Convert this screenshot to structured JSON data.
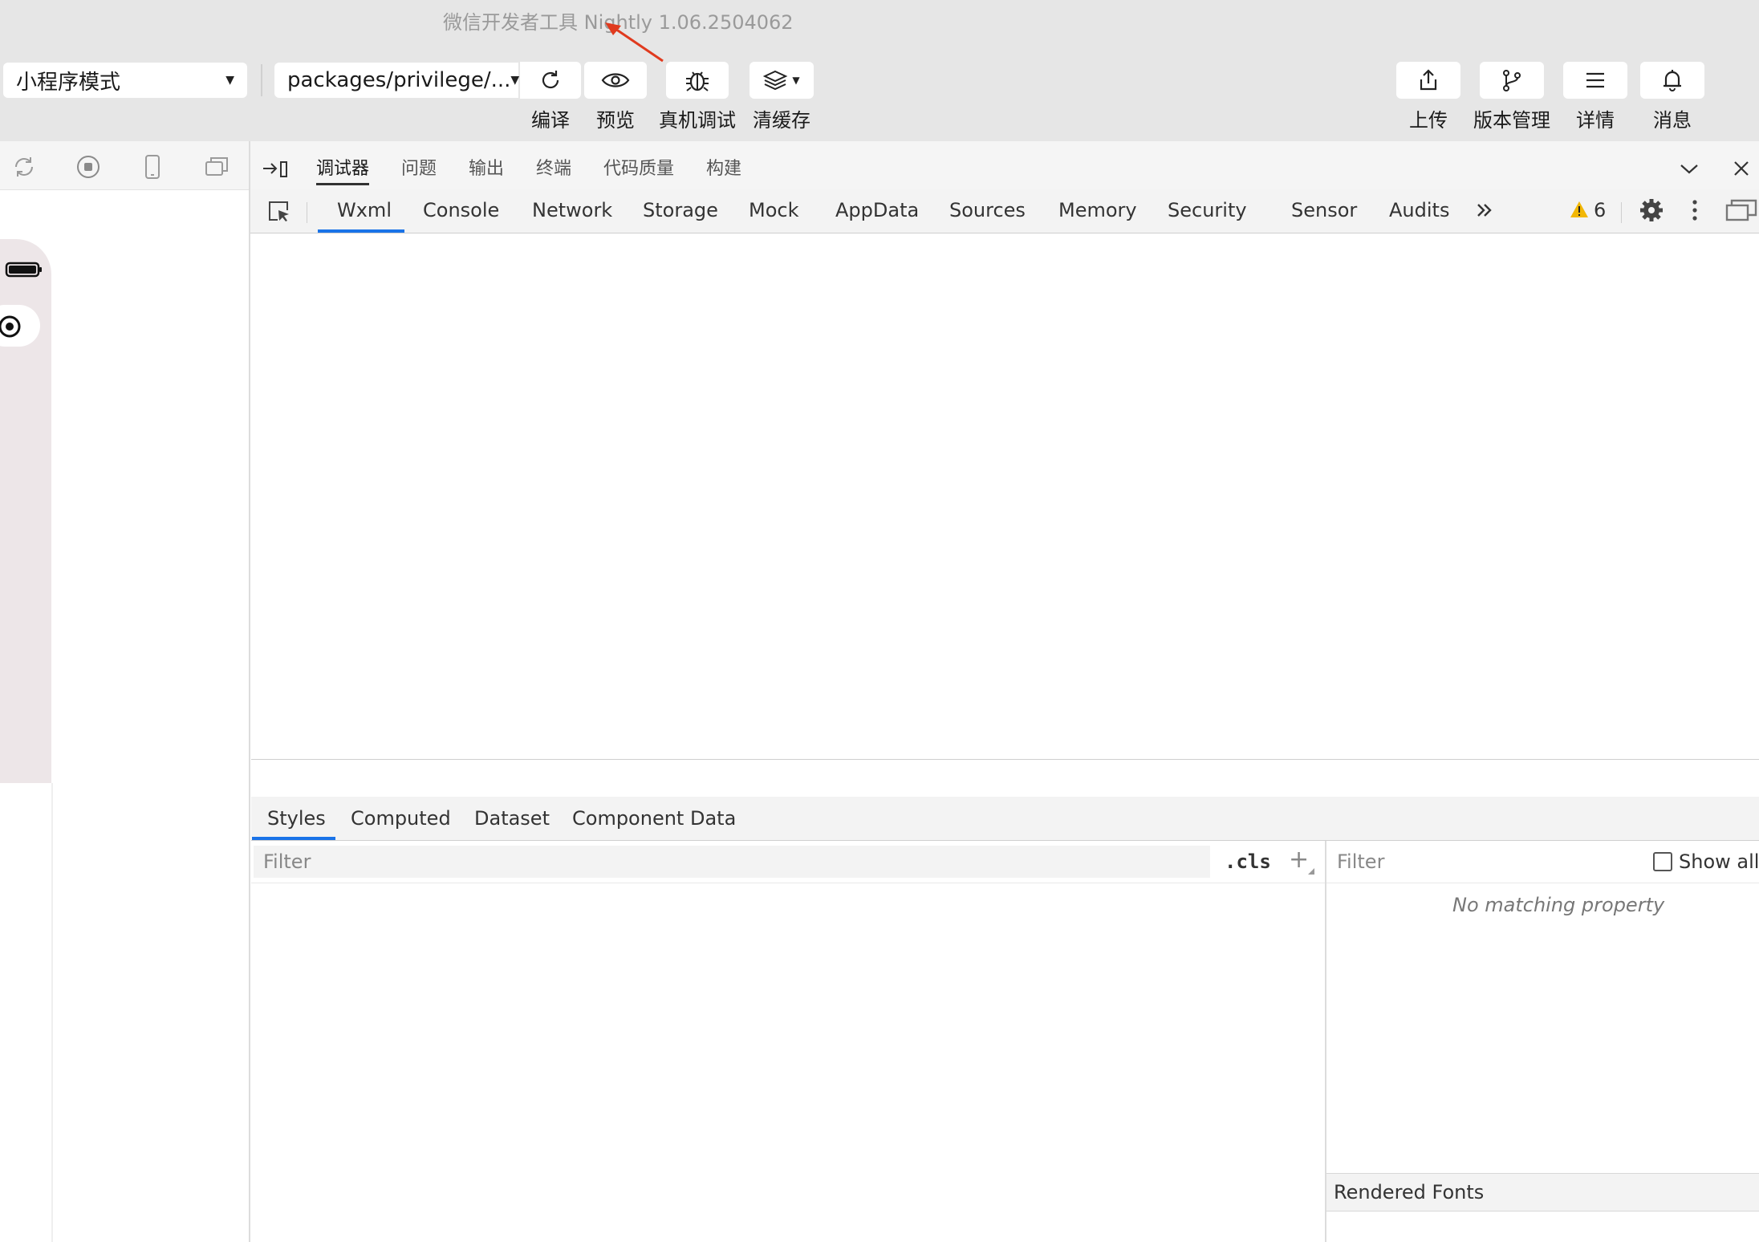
{
  "window": {
    "title": "微信开发者工具 Nightly 1.06.2504062"
  },
  "toolbar": {
    "mode_select": "小程序模式",
    "page_select": "packages/privilege/...",
    "compile": "编译",
    "preview": "预览",
    "remote_debug": "真机调试",
    "clear_cache": "清缓存",
    "upload": "上传",
    "version": "版本管理",
    "details": "详情",
    "messages": "消息"
  },
  "devtools": {
    "top_tabs": [
      "调试器",
      "问题",
      "输出",
      "终端",
      "代码质量",
      "构建"
    ],
    "panel_tabs": [
      "Wxml",
      "Console",
      "Network",
      "Storage",
      "Mock",
      "AppData",
      "Sources",
      "Memory",
      "Security",
      "Sensor",
      "Audits"
    ],
    "warning_count": "6",
    "sub_tabs": [
      "Styles",
      "Computed",
      "Dataset",
      "Component Data"
    ],
    "styles_filter_placeholder": "Filter",
    "cls_label": ".cls",
    "plus_label": "+",
    "computed_filter_placeholder": "Filter",
    "show_all_label": "Show all",
    "no_match": "No matching property",
    "rendered_fonts": "Rendered Fonts"
  },
  "colors": {
    "active_tab": "#1a73e8",
    "warning": "#f2b705",
    "annotation_arrow": "#e03a1e"
  },
  "icons": {
    "toolbar": [
      "refresh-icon",
      "eye-icon",
      "bug-icon",
      "layers-icon",
      "upload-icon",
      "branch-icon",
      "menu-icon",
      "bell-icon"
    ],
    "simulator": [
      "rotate-icon",
      "record-icon",
      "phone-icon",
      "window-icon"
    ]
  }
}
